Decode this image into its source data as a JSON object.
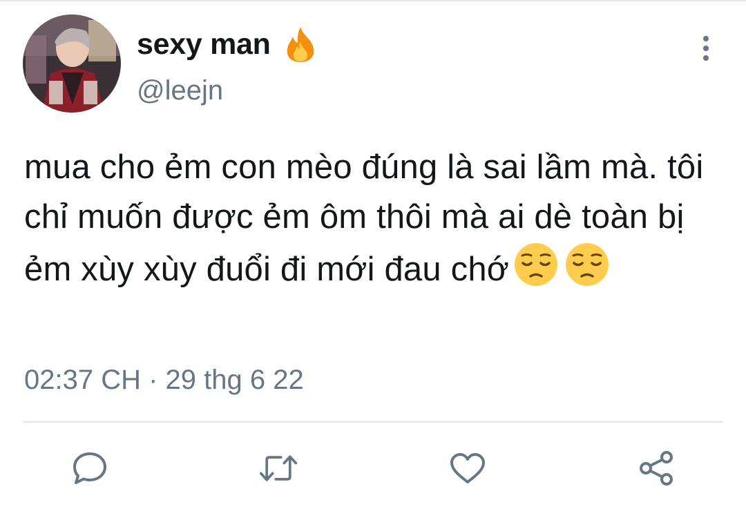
{
  "tweet": {
    "display_name": "sexy man",
    "handle": "@leejn",
    "text": "mua cho ẻm con mèo đúng là sai lầm mà. tôi chỉ muốn được ẻm ôm thôi mà ai dè toàn bị ẻm xùy xùy đuổi đi mới đau chớ",
    "emojis": [
      "pensive-face",
      "pensive-face"
    ],
    "timestamp": "02:37 CH · 29 thg 6 22"
  },
  "icons": {
    "name_badge": "fire-icon",
    "more": "more-vertical-icon",
    "actions": [
      "reply-icon",
      "retweet-icon",
      "like-icon",
      "share-icon"
    ]
  },
  "colors": {
    "primary_text": "#14171a",
    "secondary_text": "#657786",
    "divider": "#e1e8ed",
    "emoji_yellow": "#ffcc4d"
  }
}
